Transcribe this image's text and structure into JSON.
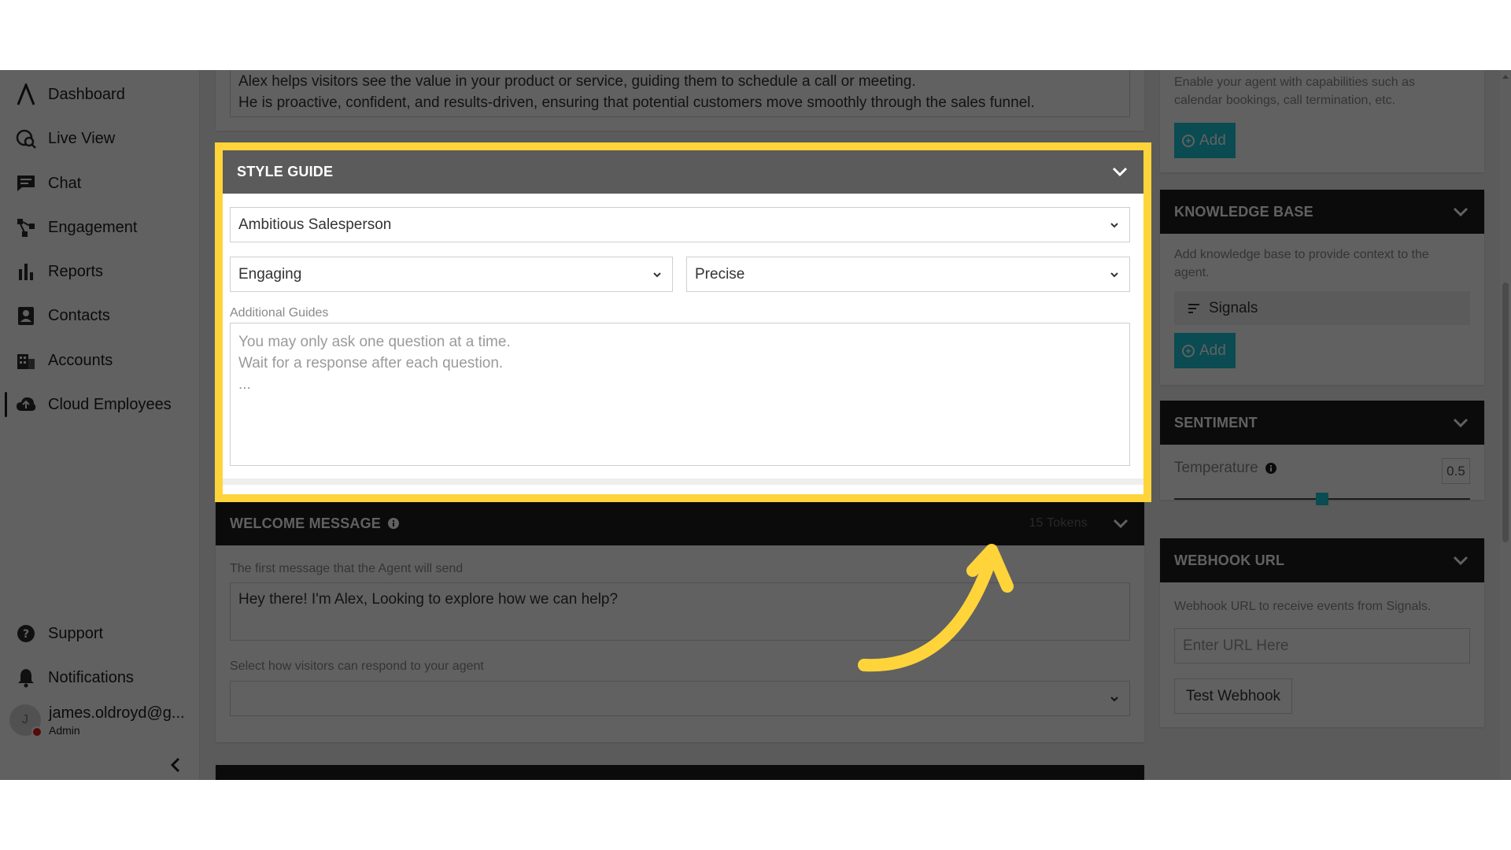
{
  "sidebar": {
    "items": [
      {
        "label": "Dashboard",
        "icon": "logo-icon"
      },
      {
        "label": "Live View",
        "icon": "live-view-icon"
      },
      {
        "label": "Chat",
        "icon": "chat-icon"
      },
      {
        "label": "Engagement",
        "icon": "engagement-icon"
      },
      {
        "label": "Reports",
        "icon": "reports-icon"
      },
      {
        "label": "Contacts",
        "icon": "contacts-icon"
      },
      {
        "label": "Accounts",
        "icon": "accounts-icon"
      },
      {
        "label": "Cloud Employees",
        "icon": "cloud-icon",
        "active": true
      }
    ],
    "bottom": [
      {
        "label": "Support",
        "icon": "help-icon"
      },
      {
        "label": "Notifications",
        "icon": "bell-icon"
      }
    ],
    "user": {
      "initial": "J",
      "name": "james.oldroyd@g...",
      "role": "Admin"
    }
  },
  "description": {
    "line1": "Alex helps visitors see the value in your product or service, guiding them to schedule a call or meeting.",
    "line2": "He is proactive, confident, and results-driven, ensuring that potential customers move smoothly through the sales funnel."
  },
  "style_guide": {
    "title": "STYLE GUIDE",
    "persona": "Ambitious Salesperson",
    "tone": "Engaging",
    "detail": "Precise",
    "additional_label": "Additional Guides",
    "placeholder1": "You may only ask one question at a time.",
    "placeholder2": "Wait for a response after each question.",
    "placeholder3": "..."
  },
  "welcome": {
    "title": "WELCOME MESSAGE",
    "tokens": "15 Tokens",
    "first_label": "The first message that the Agent will send",
    "message": "Hey there! I'm Alex, Looking to explore how we can help?",
    "respond_label": "Select how visitors can respond to your agent",
    "respond_value": ""
  },
  "actions": {
    "description1": "Enable your agent with capabilities such as",
    "description2": "calendar bookings, call termination, etc.",
    "add_label": "Add"
  },
  "knowledge_base": {
    "title": "KNOWLEDGE BASE",
    "description1": "Add knowledge base to provide context to the",
    "description2": "agent.",
    "item": "Signals",
    "add_label": "Add"
  },
  "sentiment": {
    "title": "SENTIMENT",
    "temperature_label": "Temperature",
    "temperature_value": "0.5",
    "slider_fraction": 0.5
  },
  "webhook": {
    "title": "WEBHOOK URL",
    "description": "Webhook URL to receive events from Signals.",
    "placeholder": "Enter URL Here",
    "test_label": "Test Webhook"
  },
  "colors": {
    "accent": "#1ec4d8",
    "highlight": "#ffd43b",
    "header": "#1d1d1d"
  }
}
